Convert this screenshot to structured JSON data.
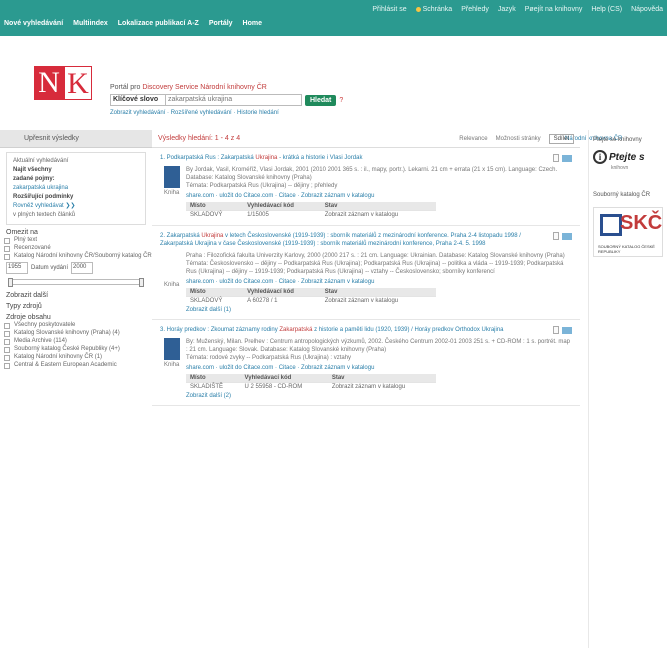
{
  "toplinks": [
    "Přihlásit se",
    "Schránka",
    "Přehledy",
    "Jazyk",
    "Pøejít na knihovny",
    "Help (CS)",
    "Nápověda"
  ],
  "mainnav": [
    "Nové vyhledávání",
    "Multiindex",
    "Lokalizace publikací A-Z",
    "Portály",
    "Home"
  ],
  "logo": {
    "n": "N",
    "k": "K"
  },
  "search": {
    "title_prefix": "Portál pro",
    "title_highlight": "Discovery Service Národní knihovny ČR",
    "select_value": "Klíčové slovo",
    "input_value": "zakarpatská ukrajina",
    "button": "Hledat",
    "help": "?",
    "links": "Zobrazit vyhledávání · Rozšířené vyhledávání · Historie hledání"
  },
  "topright_link": "Národní knihovna ČR",
  "sidebar": {
    "head": "Upřesnit výsledky",
    "current_title": "Aktuální vyhledávání",
    "current_items": [
      "Najít všechny",
      "zadané pojmy:"
    ],
    "current_link": "zakarpatská ukrajina",
    "expanders_title": "Rozšířující podmínky",
    "expanders_link": "Rovněž vyhledávat ❯❯",
    "expanders_note": "v plných textech článků",
    "limit_title": "Omezit na",
    "limit_items": [
      "Plný text",
      "Recenzované",
      "Katalog Národní knihovny ČR/Souborný katalog ČR"
    ],
    "date_from": "1955",
    "date_label": "Datum vydání",
    "date_to": "2000",
    "show_more": "Zobrazit další",
    "type_title": "Typy zdrojů",
    "source_title": "Zdroje obsahu",
    "source_items": [
      "Všechny poskytovatele",
      "Katalog Slovanské knihovny (Praha) (4)",
      "Media Archive (114)",
      "Souborný katalog České Republiky (4+)",
      "Katalog Národní knihovny ČR (1)",
      "Central & Eastern European Academic"
    ]
  },
  "results": {
    "count": "Výsledky hledání: 1 - 4 z 4",
    "relevance": "Relevance",
    "page_options": "Možnosti stránky",
    "share": "Sdílet",
    "records": [
      {
        "title_pre": "1. Podkarpatská Rus : Zakarpatská",
        "title_hl": "Ukrajina",
        "title_post": " - krátká a historie i Vlasi Jordak",
        "type": "Kniha",
        "text": "By Jordak, Vasil, Kroméříž, Vlasi Jordak, 2001 (2010 2001 365 s. : il., mapy, portr.). Lekarni. 21 cm + errata (21 x 15 cm). Language: Czech. Database: Katalog Slovanské knihovny (Praha)",
        "subjects": "Témata: Podkarpatská Rus (Ukrajina) -- dějiny ; přehledy",
        "links": "share.com · uložit do Citace.com · Citace · Zobrazit záznam v katalogu",
        "holdings_head": [
          "Místo",
          "Vyhledávací kód",
          "Stav"
        ],
        "holdings_rows": [
          [
            "SKLADOVÝ",
            "1/15005",
            "Zobrazit záznam v katalogu"
          ]
        ],
        "more": ""
      },
      {
        "title_pre": "2. Zakarpatská",
        "title_hl": "Ukrajina",
        "title_post": " v letech Československé (1919-1939) : sborník materiálů z mezinárodní konference. Praha 2-4 listopadu 1998 / Zakarpatská Ukrajina v čase Československé (1919-1939) : sborník materiálů mezinárodní konference, Praha 2-4. 5. 1998",
        "type": "Kniha",
        "text": "Praha : Filozofická fakulta Univerzity Karlovy, 2000 (2000 217 s. : 21 cm. Language: Ukrainian. Database: Katalog Slovanské knihovny (Praha)",
        "subjects": "Témata: Československo -- dějiny -- Podkarpatská Rus (Ukrajina); Podkarpatská Rus (Ukrajina) -- politika a vláda -- 1919-1939; Podkarpatská Rus (Ukrajina) -- dějiny -- 1919-1939; Podkarpatská Rus (Ukrajina) -- vztahy -- Československo; sborníky konferencí",
        "links": "share.com · uložit do Citace.com · Citace · Zobrazit záznam v katalogu",
        "holdings_head": [
          "Místo",
          "Vyhledávací kód",
          "Stav"
        ],
        "holdings_rows": [
          [
            "SKLADOVÝ",
            "A 60278 / 1",
            "Zobrazit záznam v katalogu"
          ]
        ],
        "more": "Zobrazit další (1)"
      },
      {
        "title_pre": "3. Horáy predkov : Zkoumat záznamy rodiny",
        "title_hl": "Zakarpatská",
        "title_post": " z historie a paměti lidu (1920, 1939) / Horáy predkov Orthodox Ukrajina",
        "type": "Kniha",
        "text": "By: Muženský, Milan. Prelhev : Centrum antropologických výzkumů, 2002. Českého Centrum 2002-01 2003 251 s. + CD-ROM : 1 s. portrét. map : 21 cm. Language: Slovak. Database: Katalog Slovanské knihovny (Praha)",
        "subjects": "Témata: rodové zvyky -- Podkarpatská Rus (Ukrajina) : vztahy",
        "links": "share.com · uložit do Citace.com · Citace · Zobrazit záznam v katalogu",
        "holdings_head": [
          "Místo",
          "Vyhledávací kód",
          "Stav"
        ],
        "holdings_rows": [
          [
            "SKLADIŠTĚ",
            "U 2 55958 - CD-ROM",
            "Zobrazit záznam v katalogu"
          ]
        ],
        "more": "Zobrazit další (2)"
      }
    ]
  },
  "right": {
    "title1": "Ptejte se knihovny",
    "ptejte_word": "Ptejte s",
    "ptejte_sub": "knihovn",
    "title2": "Souborný katalog ČR",
    "skc_text": "SKČ",
    "skc_small": "SOUBORNÝ KATALOG ČESKÉ REPUBLIKY"
  },
  "colors": {
    "teal": "#2b9a90",
    "red": "#d72b3b",
    "link": "#2a7fa9",
    "button": "#1f8a5c"
  }
}
